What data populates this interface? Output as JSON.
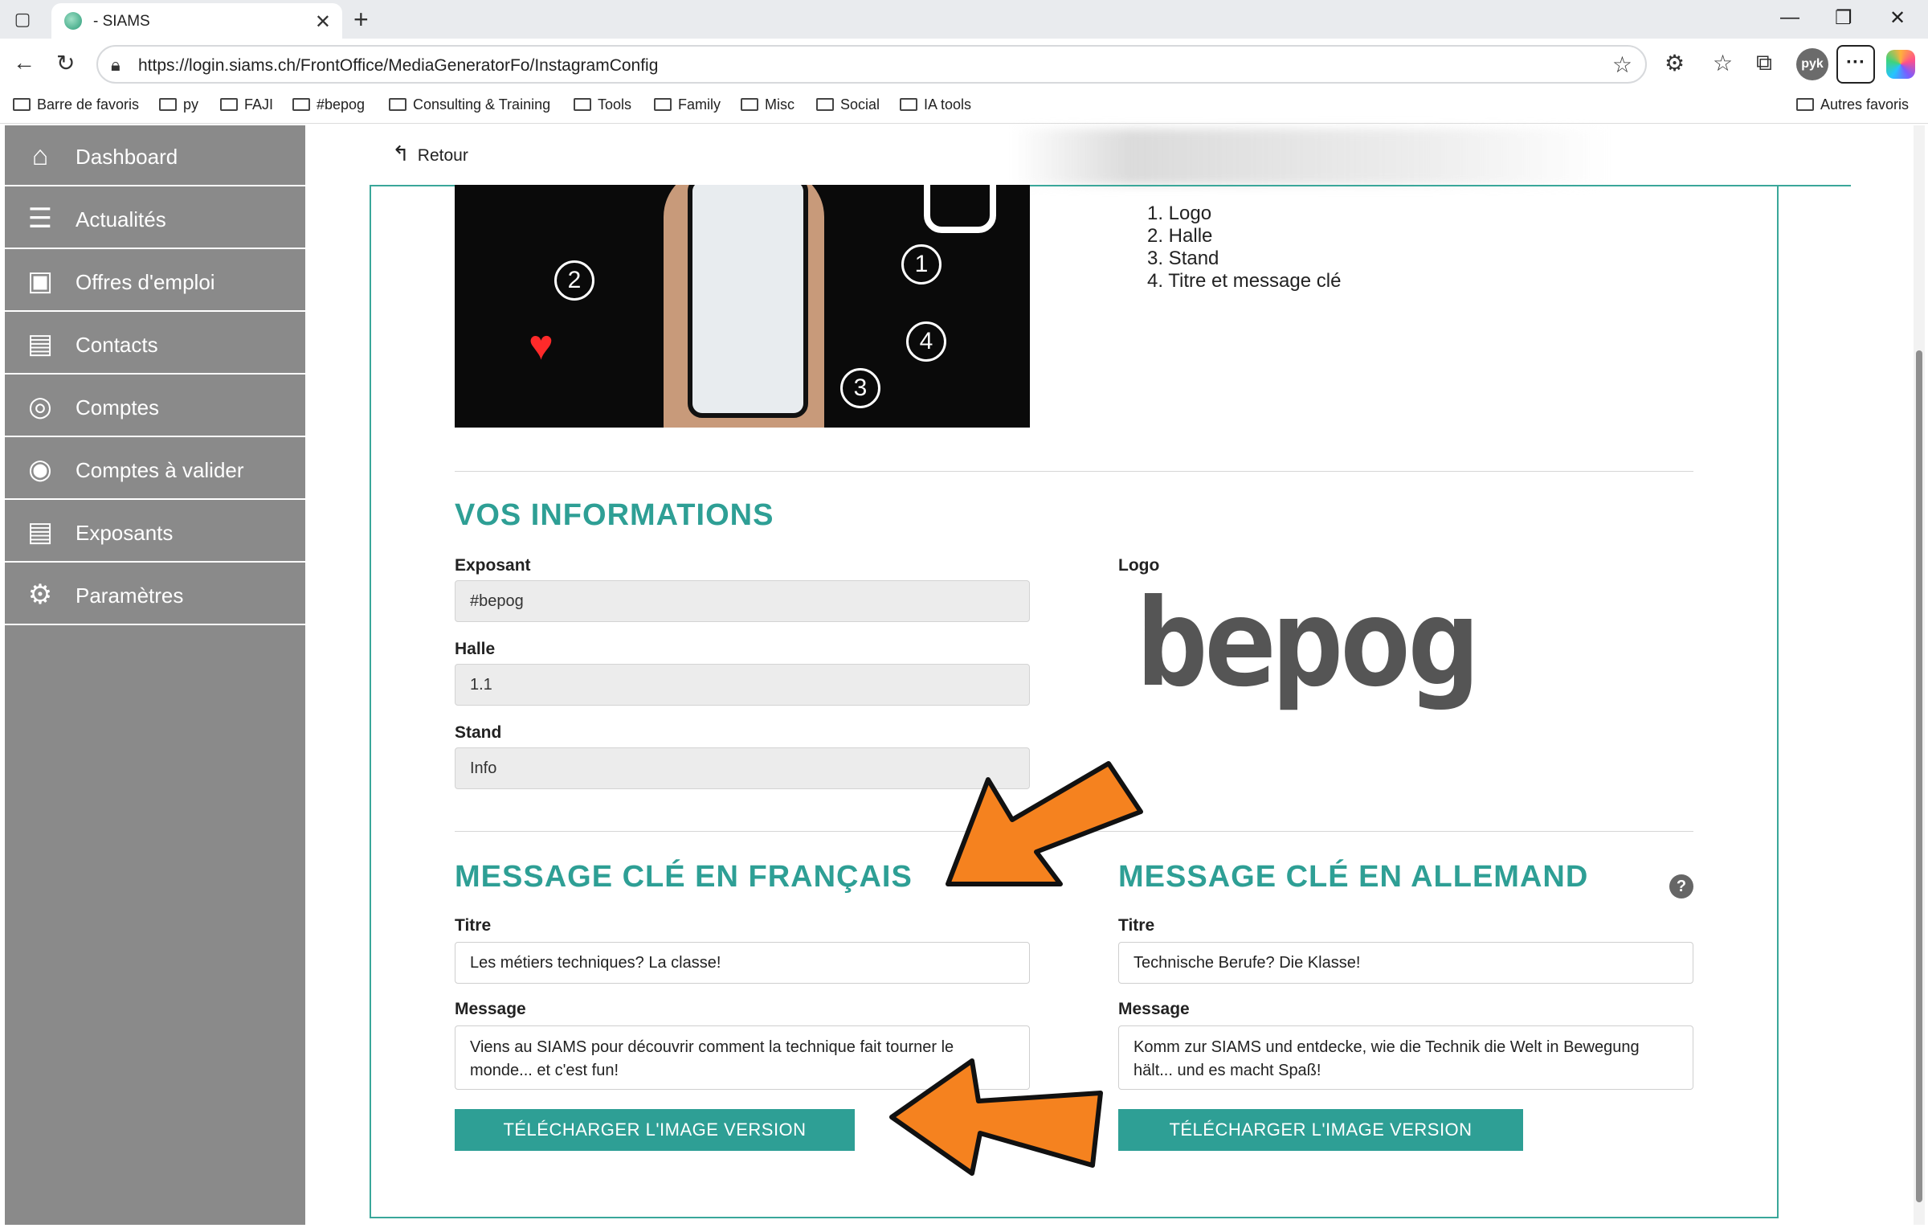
{
  "browser": {
    "tab_title": "- SIAMS",
    "url": "https://login.siams.ch/FrontOffice/MediaGeneratorFo/InstagramConfig",
    "profile_initials": "pyk",
    "bookmarks": [
      "Barre de favoris",
      "py",
      "FAJI",
      "#bepog",
      "Consulting & Training",
      "Tools",
      "Family",
      "Misc",
      "Social",
      "IA tools"
    ],
    "other_bookmarks": "Autres favoris"
  },
  "sidebar": {
    "items": [
      {
        "label": "Dashboard",
        "icon": "home-icon"
      },
      {
        "label": "Actualités",
        "icon": "news-icon"
      },
      {
        "label": "Offres d'emploi",
        "icon": "briefcase-icon"
      },
      {
        "label": "Contacts",
        "icon": "contact-card-icon"
      },
      {
        "label": "Comptes",
        "icon": "user-circle-icon"
      },
      {
        "label": "Comptes à valider",
        "icon": "user-check-icon"
      },
      {
        "label": "Exposants",
        "icon": "exhibitor-card-icon"
      },
      {
        "label": "Paramètres",
        "icon": "gear-icon"
      }
    ]
  },
  "main": {
    "back_label": "Retour",
    "preview_callouts": [
      "1",
      "2",
      "3",
      "4"
    ],
    "legend": [
      "1. Logo",
      "2. Halle",
      "3. Stand",
      "4. Titre et message clé"
    ],
    "info": {
      "title": "VOS INFORMATIONS",
      "exposant_label": "Exposant",
      "exposant_value": "#bepog",
      "halle_label": "Halle",
      "halle_value": "1.1",
      "stand_label": "Stand",
      "stand_value": "Info",
      "logo_label": "Logo",
      "logo_text": "bepog"
    },
    "fr": {
      "title": "MESSAGE CLÉ EN FRANÇAIS",
      "titre_label": "Titre",
      "titre_value": "Les métiers techniques? La classe!",
      "message_label": "Message",
      "message_value": "Viens au SIAMS pour découvrir comment la technique fait tourner le monde... et c'est fun!",
      "button": "TÉLÉCHARGER L'IMAGE VERSION FRANÇAISE"
    },
    "de": {
      "title": "MESSAGE CLÉ EN ALLEMAND",
      "titre_label": "Titre",
      "titre_value": "Technische Berufe? Die Klasse!",
      "message_label": "Message",
      "message_value": "Komm zur SIAMS und entdecke, wie die Technik die Welt in Bewegung hält... und es macht Spaß!",
      "button": "TÉLÉCHARGER L'IMAGE VERSION ALLEMANDE"
    },
    "help_glyph": "?"
  },
  "colors": {
    "accent": "#2e9f95",
    "sidebar": "#8a8a8a",
    "annotation_arrow": "#f5821f"
  }
}
